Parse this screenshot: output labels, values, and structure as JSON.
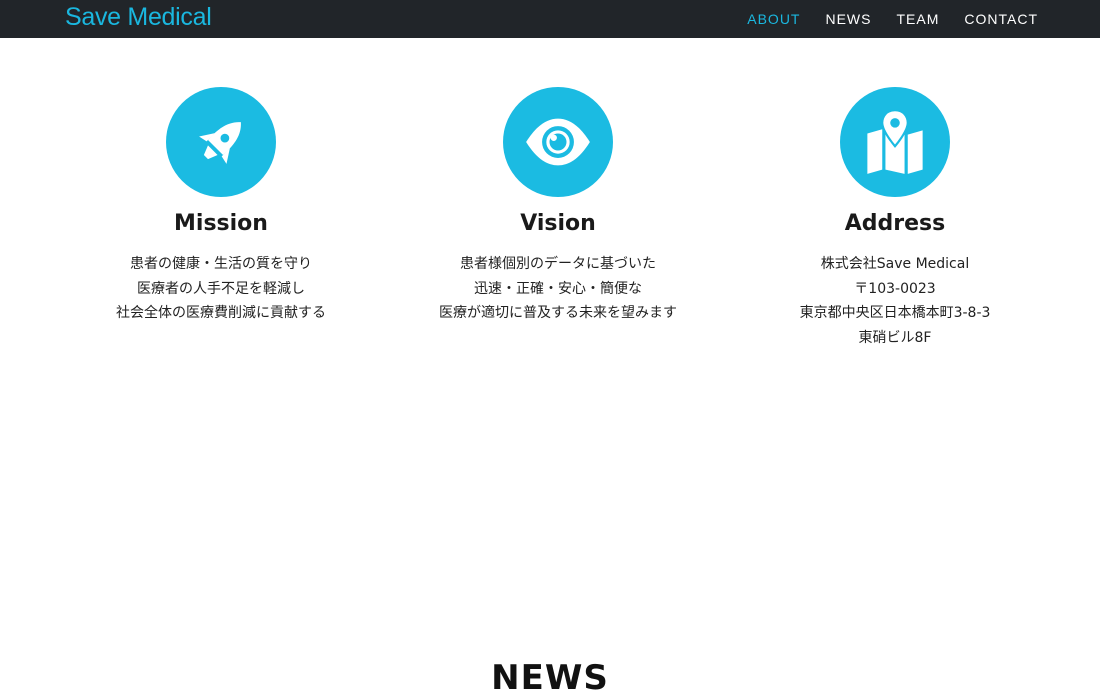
{
  "navbar": {
    "brand": "Save Medical",
    "links": [
      {
        "label": "ABOUT",
        "active": true
      },
      {
        "label": "NEWS",
        "active": false
      },
      {
        "label": "TEAM",
        "active": false
      },
      {
        "label": "CONTACT",
        "active": false
      }
    ]
  },
  "theme": {
    "accent": "#1bbbe2",
    "navbar_bg": "#212529"
  },
  "features": [
    {
      "icon": "rocket-icon",
      "title": "Mission",
      "lines": [
        "患者の健康・生活の質を守り",
        "医療者の人手不足を軽減し",
        "社会全体の医療費削減に貢献する"
      ]
    },
    {
      "icon": "eye-icon",
      "title": "Vision",
      "lines": [
        "患者様個別のデータに基づいた",
        "迅速・正確・安心・簡便な",
        "医療が適切に普及する未来を望みます"
      ]
    },
    {
      "icon": "map-icon",
      "title": "Address",
      "lines": [
        "株式会社Save Medical",
        "〒103-0023",
        "東京都中央区日本橋本町3-8-3",
        "東硝ビル8F"
      ]
    }
  ],
  "news": {
    "heading": "NEWS"
  }
}
